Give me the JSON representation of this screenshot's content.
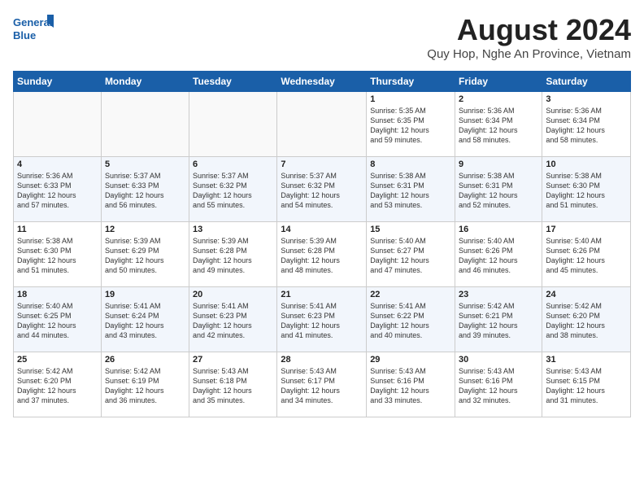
{
  "header": {
    "logo_line1": "General",
    "logo_line2": "Blue",
    "month_title": "August 2024",
    "location": "Quy Hop, Nghe An Province, Vietnam"
  },
  "weekdays": [
    "Sunday",
    "Monday",
    "Tuesday",
    "Wednesday",
    "Thursday",
    "Friday",
    "Saturday"
  ],
  "weeks": [
    [
      {
        "day": "",
        "info": ""
      },
      {
        "day": "",
        "info": ""
      },
      {
        "day": "",
        "info": ""
      },
      {
        "day": "",
        "info": ""
      },
      {
        "day": "1",
        "info": "Sunrise: 5:35 AM\nSunset: 6:35 PM\nDaylight: 12 hours\nand 59 minutes."
      },
      {
        "day": "2",
        "info": "Sunrise: 5:36 AM\nSunset: 6:34 PM\nDaylight: 12 hours\nand 58 minutes."
      },
      {
        "day": "3",
        "info": "Sunrise: 5:36 AM\nSunset: 6:34 PM\nDaylight: 12 hours\nand 58 minutes."
      }
    ],
    [
      {
        "day": "4",
        "info": "Sunrise: 5:36 AM\nSunset: 6:33 PM\nDaylight: 12 hours\nand 57 minutes."
      },
      {
        "day": "5",
        "info": "Sunrise: 5:37 AM\nSunset: 6:33 PM\nDaylight: 12 hours\nand 56 minutes."
      },
      {
        "day": "6",
        "info": "Sunrise: 5:37 AM\nSunset: 6:32 PM\nDaylight: 12 hours\nand 55 minutes."
      },
      {
        "day": "7",
        "info": "Sunrise: 5:37 AM\nSunset: 6:32 PM\nDaylight: 12 hours\nand 54 minutes."
      },
      {
        "day": "8",
        "info": "Sunrise: 5:38 AM\nSunset: 6:31 PM\nDaylight: 12 hours\nand 53 minutes."
      },
      {
        "day": "9",
        "info": "Sunrise: 5:38 AM\nSunset: 6:31 PM\nDaylight: 12 hours\nand 52 minutes."
      },
      {
        "day": "10",
        "info": "Sunrise: 5:38 AM\nSunset: 6:30 PM\nDaylight: 12 hours\nand 51 minutes."
      }
    ],
    [
      {
        "day": "11",
        "info": "Sunrise: 5:38 AM\nSunset: 6:30 PM\nDaylight: 12 hours\nand 51 minutes."
      },
      {
        "day": "12",
        "info": "Sunrise: 5:39 AM\nSunset: 6:29 PM\nDaylight: 12 hours\nand 50 minutes."
      },
      {
        "day": "13",
        "info": "Sunrise: 5:39 AM\nSunset: 6:28 PM\nDaylight: 12 hours\nand 49 minutes."
      },
      {
        "day": "14",
        "info": "Sunrise: 5:39 AM\nSunset: 6:28 PM\nDaylight: 12 hours\nand 48 minutes."
      },
      {
        "day": "15",
        "info": "Sunrise: 5:40 AM\nSunset: 6:27 PM\nDaylight: 12 hours\nand 47 minutes."
      },
      {
        "day": "16",
        "info": "Sunrise: 5:40 AM\nSunset: 6:26 PM\nDaylight: 12 hours\nand 46 minutes."
      },
      {
        "day": "17",
        "info": "Sunrise: 5:40 AM\nSunset: 6:26 PM\nDaylight: 12 hours\nand 45 minutes."
      }
    ],
    [
      {
        "day": "18",
        "info": "Sunrise: 5:40 AM\nSunset: 6:25 PM\nDaylight: 12 hours\nand 44 minutes."
      },
      {
        "day": "19",
        "info": "Sunrise: 5:41 AM\nSunset: 6:24 PM\nDaylight: 12 hours\nand 43 minutes."
      },
      {
        "day": "20",
        "info": "Sunrise: 5:41 AM\nSunset: 6:23 PM\nDaylight: 12 hours\nand 42 minutes."
      },
      {
        "day": "21",
        "info": "Sunrise: 5:41 AM\nSunset: 6:23 PM\nDaylight: 12 hours\nand 41 minutes."
      },
      {
        "day": "22",
        "info": "Sunrise: 5:41 AM\nSunset: 6:22 PM\nDaylight: 12 hours\nand 40 minutes."
      },
      {
        "day": "23",
        "info": "Sunrise: 5:42 AM\nSunset: 6:21 PM\nDaylight: 12 hours\nand 39 minutes."
      },
      {
        "day": "24",
        "info": "Sunrise: 5:42 AM\nSunset: 6:20 PM\nDaylight: 12 hours\nand 38 minutes."
      }
    ],
    [
      {
        "day": "25",
        "info": "Sunrise: 5:42 AM\nSunset: 6:20 PM\nDaylight: 12 hours\nand 37 minutes."
      },
      {
        "day": "26",
        "info": "Sunrise: 5:42 AM\nSunset: 6:19 PM\nDaylight: 12 hours\nand 36 minutes."
      },
      {
        "day": "27",
        "info": "Sunrise: 5:43 AM\nSunset: 6:18 PM\nDaylight: 12 hours\nand 35 minutes."
      },
      {
        "day": "28",
        "info": "Sunrise: 5:43 AM\nSunset: 6:17 PM\nDaylight: 12 hours\nand 34 minutes."
      },
      {
        "day": "29",
        "info": "Sunrise: 5:43 AM\nSunset: 6:16 PM\nDaylight: 12 hours\nand 33 minutes."
      },
      {
        "day": "30",
        "info": "Sunrise: 5:43 AM\nSunset: 6:16 PM\nDaylight: 12 hours\nand 32 minutes."
      },
      {
        "day": "31",
        "info": "Sunrise: 5:43 AM\nSunset: 6:15 PM\nDaylight: 12 hours\nand 31 minutes."
      }
    ]
  ]
}
